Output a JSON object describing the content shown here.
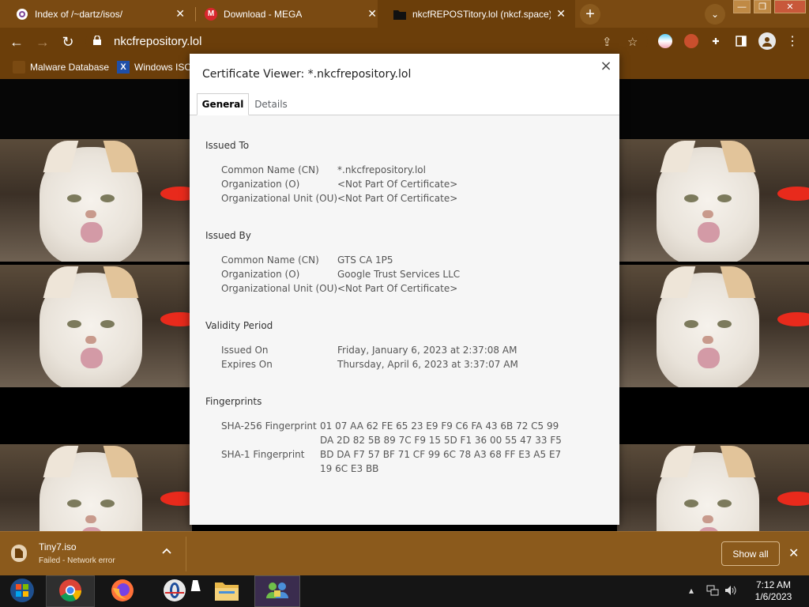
{
  "browser": {
    "tabs": [
      {
        "title": "Index of /~dartz/isos/",
        "favicon": "tor-onion-icon"
      },
      {
        "title": "Download - MEGA",
        "favicon": "mega-icon",
        "favicon_text": "M"
      },
      {
        "title": "nkcfREPOSTitory.lol (nkcf.space)",
        "favicon": "folder-icon",
        "active": true
      }
    ],
    "newtab_label": "+",
    "tab_search_label": "⌄",
    "window_buttons": [
      "—",
      "❐",
      "✕"
    ],
    "url": "nkcfrepository.lol",
    "bookmarks": [
      {
        "label": "Malware Database",
        "icon": "malware-db-icon"
      },
      {
        "label": "Windows ISO",
        "icon": "windows-iso-icon",
        "icon_text": "X"
      }
    ],
    "accent": "#6b3e0a"
  },
  "dialog": {
    "title": "Certificate Viewer: *.nkcfrepository.lol",
    "close_label": "×",
    "tabs": [
      "General",
      "Details"
    ],
    "sections": {
      "issued_to": {
        "heading": "Issued To",
        "rows": [
          {
            "label": "Common Name (CN)",
            "value": "*.nkcfrepository.lol"
          },
          {
            "label": "Organization (O)",
            "value": "<Not Part Of Certificate>"
          },
          {
            "label": "Organizational Unit (OU)",
            "value": "<Not Part Of Certificate>"
          }
        ]
      },
      "issued_by": {
        "heading": "Issued By",
        "rows": [
          {
            "label": "Common Name (CN)",
            "value": "GTS CA 1P5"
          },
          {
            "label": "Organization (O)",
            "value": "Google Trust Services LLC"
          },
          {
            "label": "Organizational Unit (OU)",
            "value": "<Not Part Of Certificate>"
          }
        ]
      },
      "validity": {
        "heading": "Validity Period",
        "rows": [
          {
            "label": "Issued On",
            "value": "Friday, January 6, 2023 at 2:37:08 AM"
          },
          {
            "label": "Expires On",
            "value": "Thursday, April 6, 2023 at 3:37:07 AM"
          }
        ]
      },
      "fingerprints": {
        "heading": "Fingerprints",
        "rows": [
          {
            "label": "SHA-256 Fingerprint",
            "line1": "01 07 AA 62 FE 65 23 E9 F9 C6 FA 43 6B 72 C5 99",
            "line2": "DA 2D 82 5B 89 7C F9 15 5D F1 36 00 55 47 33 F5"
          },
          {
            "label": "SHA-1 Fingerprint",
            "line1": "BD DA F7 57 BF 71 CF 99 6C 78 A3 68 FF E3 A5 E7",
            "line2": "19 6C E3 BB"
          }
        ]
      }
    }
  },
  "download": {
    "filename": "Tiny7.iso",
    "status": "Failed - Network error",
    "show_all_label": "Show all",
    "close_label": "✕"
  },
  "taskbar": {
    "apps": [
      "start-orb-icon",
      "chrome-icon",
      "firefox-icon",
      "opera-icon",
      "file-explorer-icon",
      "network-users-icon"
    ],
    "time": "7:12 AM",
    "date": "1/6/2023"
  }
}
